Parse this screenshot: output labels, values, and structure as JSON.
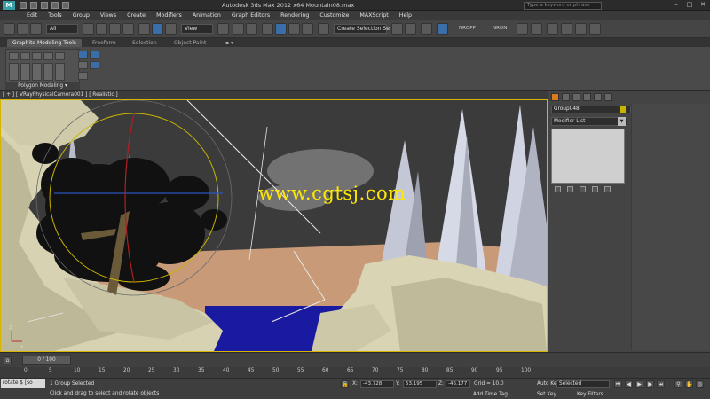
{
  "window": {
    "title": "Autodesk 3ds Max  2012 x64     Mountain08.max",
    "search_placeholder": "Type a keyword or phrase"
  },
  "menu": [
    "Edit",
    "Tools",
    "Group",
    "Views",
    "Create",
    "Modifiers",
    "Animation",
    "Graph Editors",
    "Rendering",
    "Customize",
    "MAXScript",
    "Help"
  ],
  "toolbar": {
    "filter": "All",
    "ref_coord": "View",
    "selection_set": "Create Selection Se",
    "nrops": "NROPP",
    "nron": "NRON"
  },
  "ribbon": {
    "tabs": [
      "Graphite Modeling Tools",
      "Freeform",
      "Selection",
      "Object Paint"
    ],
    "panel_label": "Polygon Modeling"
  },
  "viewport": {
    "label": "[ + ] [ VRayPhysicalCamera001 ] [ Realistic ]",
    "watermark": "www.cgtsj.com"
  },
  "command_panel": {
    "object_name": "Group048",
    "modifier_list": "Modifier List"
  },
  "timeline": {
    "slider": "0 / 100",
    "ticks": [
      "0",
      "5",
      "10",
      "15",
      "20",
      "25",
      "30",
      "35",
      "40",
      "45",
      "50",
      "55",
      "60",
      "65",
      "70",
      "75",
      "80",
      "85",
      "90",
      "95",
      "100"
    ]
  },
  "status": {
    "maxscript": "rotate $ [so",
    "selected": "1 Group Selected",
    "prompt": "Click and drag to select and rotate objects",
    "x": "-43.728",
    "y": "53.195",
    "z": "-46.177",
    "grid": "Grid = 10.0",
    "add_time_tag": "Add Time Tag",
    "auto_key": "Auto Key",
    "set_key": "Set Key",
    "selected_option": "Selected",
    "key_filters": "Key Filters..."
  },
  "colors": {
    "accent_yellow": "#ffe800",
    "viewport_border": "#d6b400",
    "active_tab": "#d97a1e"
  }
}
